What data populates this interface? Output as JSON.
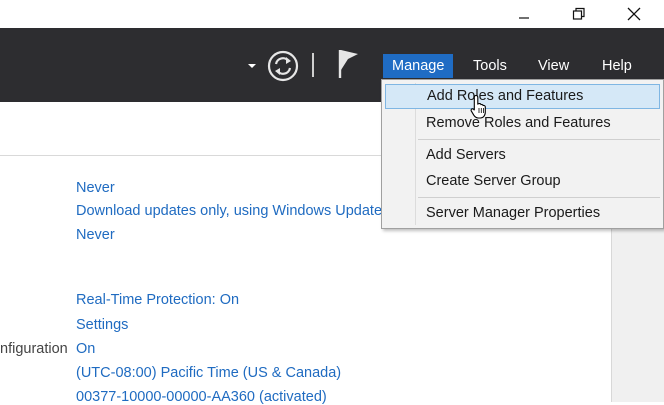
{
  "window": {
    "minimize_icon": "minimize-icon",
    "restore_icon": "restore-icon",
    "close_icon": "close-icon"
  },
  "toolbar": {
    "menu": [
      {
        "label": "Manage",
        "active": true
      },
      {
        "label": "Tools"
      },
      {
        "label": "View"
      },
      {
        "label": "Help"
      }
    ]
  },
  "manage_menu": {
    "items": [
      {
        "label": "Add Roles and Features",
        "hover": true
      },
      {
        "label": "Remove Roles and Features"
      },
      {
        "label": "Add Servers"
      },
      {
        "label": "Create Server Group"
      },
      {
        "label": "Server Manager Properties"
      }
    ]
  },
  "properties": {
    "values": [
      "Never",
      "Download updates only, using Windows Update",
      "Never",
      "Real-Time Protection: On",
      "Settings",
      "On",
      "(UTC-08:00) Pacific Time (US & Canada)",
      "00377-10000-00000-AA360 (activated)"
    ],
    "partial_label": "nfiguration"
  },
  "colors": {
    "toolbar_bg": "#2d2d30",
    "accent": "#1f6cc4",
    "link": "#1f6bc1",
    "hover_bg": "#d5e8f7"
  }
}
